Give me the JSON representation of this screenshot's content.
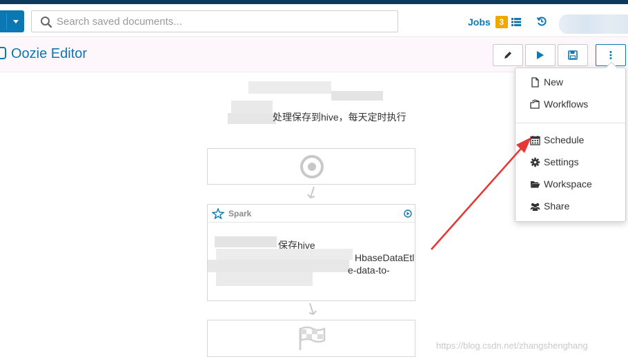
{
  "header": {
    "search_placeholder": "Search saved documents...",
    "jobs_label": "Jobs",
    "jobs_count": "3"
  },
  "editor": {
    "title": "Oozie Editor"
  },
  "workflow": {
    "description_visible": "处理保存到hive，每天定时执行",
    "spark_node": {
      "label": "Spark",
      "line1": "保存hive",
      "line2": "HbaseDataEtl",
      "line3": "e-data-to-"
    }
  },
  "menu": {
    "items": [
      {
        "label": "New",
        "icon": "file-icon"
      },
      {
        "label": "Workflows",
        "icon": "workflow-icon"
      },
      {
        "label": "Schedule",
        "icon": "calendar-icon"
      },
      {
        "label": "Settings",
        "icon": "gear-icon"
      },
      {
        "label": "Workspace",
        "icon": "folder-open-icon"
      },
      {
        "label": "Share",
        "icon": "users-icon"
      }
    ]
  },
  "watermark": "https://blog.csdn.net/zhangshenghang",
  "colors": {
    "brand": "#0b78b3",
    "badge": "#f0a800",
    "annotation_arrow": "#e53935"
  }
}
